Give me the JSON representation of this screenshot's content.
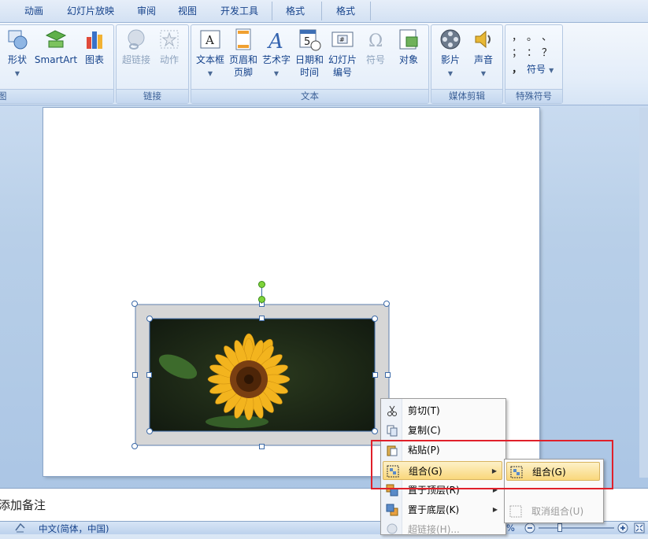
{
  "tabs": [
    "动画",
    "幻灯片放映",
    "审阅",
    "视图",
    "开发工具",
    "格式",
    "格式"
  ],
  "ribbon": {
    "groups": [
      {
        "label": "插图",
        "buttons": [
          {
            "label": "形状"
          },
          {
            "label": "SmartArt"
          },
          {
            "label": "图表"
          }
        ]
      },
      {
        "label": "链接",
        "buttons": [
          {
            "label": "超链接"
          },
          {
            "label": "动作"
          }
        ]
      },
      {
        "label": "文本",
        "buttons": [
          {
            "label": "文本框"
          },
          {
            "label_1": "页眉和",
            "label_2": "页脚"
          },
          {
            "label": "艺术字"
          },
          {
            "label_1": "日期和",
            "label_2": "时间"
          },
          {
            "label_1": "幻灯片",
            "label_2": "编号"
          },
          {
            "label": "符号"
          },
          {
            "label": "对象"
          }
        ]
      },
      {
        "label": "媒体剪辑",
        "buttons": [
          {
            "label": "影片"
          },
          {
            "label": "声音"
          }
        ]
      },
      {
        "label": "特殊符号",
        "buttons": [
          {
            "label": "符号"
          }
        ]
      }
    ],
    "first_group_label_visible": "图",
    "symbol_glyphs": [
      "，",
      "。",
      "、",
      "；",
      "：",
      "？",
      "，"
    ]
  },
  "notes": {
    "placeholder": "添加备注",
    "visible_text": "添加备注"
  },
  "status": {
    "language": "中文(简体，中国)",
    "zoom_suffix": "%"
  },
  "context_menu": {
    "items": [
      {
        "label": "剪切(T)",
        "icon": "scissors-icon"
      },
      {
        "label": "复制(C)",
        "icon": "copy-icon"
      },
      {
        "label": "粘贴(P)",
        "icon": "paste-icon"
      },
      {
        "label": "组合(G)",
        "icon": "group-icon",
        "submenu": true,
        "highlighted": true
      },
      {
        "label": "置于顶层(R)",
        "icon": "bring-to-front-icon",
        "submenu": true
      },
      {
        "label": "置于底层(K)",
        "icon": "send-to-back-icon",
        "submenu": true
      },
      {
        "label": "超链接(H)...",
        "icon": "hyperlink-icon",
        "disabled": true
      }
    ]
  },
  "submenu": {
    "items": [
      {
        "label": "组合(G)",
        "highlighted": true
      },
      {
        "label": "取消组合(U)",
        "disabled": true
      }
    ]
  },
  "colors": {
    "accent": "#15428b",
    "highlight": "#f9d77b",
    "red_box": "#e0202a"
  }
}
